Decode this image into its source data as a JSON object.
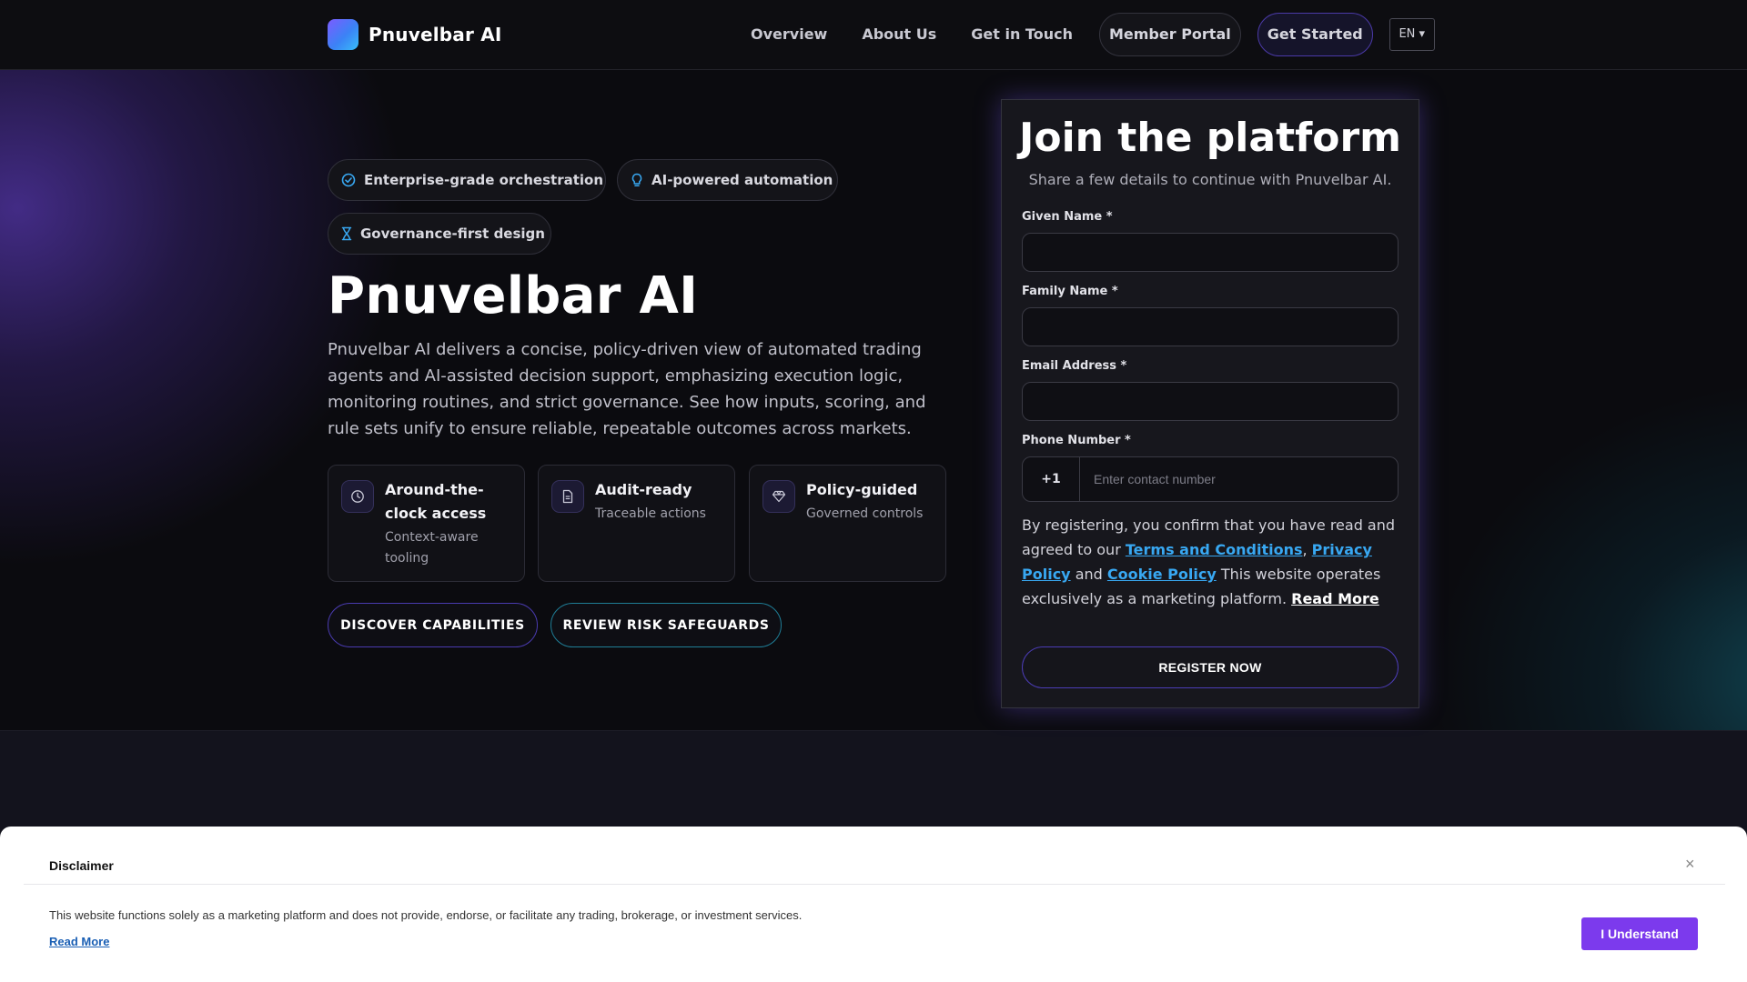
{
  "header": {
    "brand": "Pnuvelbar AI",
    "nav": [
      "Overview",
      "About Us",
      "Get in Touch"
    ],
    "member_portal": "Member Portal",
    "get_started": "Get Started",
    "language": "EN ▾"
  },
  "hero": {
    "chips": [
      "Enterprise-grade orchestration",
      "AI-powered automation",
      "Governance-first design"
    ],
    "title": "Pnuvelbar AI",
    "description": "Pnuvelbar AI delivers a concise, policy-driven view of automated trading agents and AI-assisted decision support, emphasizing execution logic, monitoring routines, and strict governance. See how inputs, scoring, and rule sets unify to ensure reliable, repeatable outcomes across markets.",
    "features": [
      {
        "title": "Around-the-clock access",
        "subtitle": "Context-aware tooling",
        "icon": "clock-icon"
      },
      {
        "title": "Audit-ready",
        "subtitle": "Traceable actions",
        "icon": "document-icon"
      },
      {
        "title": "Policy-guided",
        "subtitle": "Governed controls",
        "icon": "diamond-icon"
      }
    ],
    "cta_primary": "DISCOVER CAPABILITIES",
    "cta_secondary": "REVIEW RISK SAFEGUARDS"
  },
  "form": {
    "title": "Join the platform",
    "subtitle": "Share a few details to continue with Pnuvelbar AI.",
    "given_name_label": "Given Name *",
    "family_name_label": "Family Name *",
    "email_label": "Email Address *",
    "phone_label": "Phone Number *",
    "phone_code": "+1",
    "phone_placeholder": "Enter contact number",
    "consent_prefix": "By registering, you confirm that you have read and agreed to our",
    "terms": "Terms and Conditions",
    "privacy": "Privacy Policy",
    "and": "and",
    "cookie": "Cookie Policy",
    "consent_suffix": "This website operates exclusively as a marketing platform.",
    "read_more": "Read More",
    "submit": "REGISTER NOW"
  },
  "disclaimer": {
    "title": "Disclaimer",
    "close": "×",
    "text": "This website functions solely as a marketing platform and does not provide, endorse, or facilitate any trading, brokerage, or investment services.",
    "read_more": "Read More",
    "button": "I Understand"
  },
  "colors": {
    "accent_purple": "#7c3aed",
    "link_blue": "#38a8f2",
    "background": "#0c0c10"
  }
}
